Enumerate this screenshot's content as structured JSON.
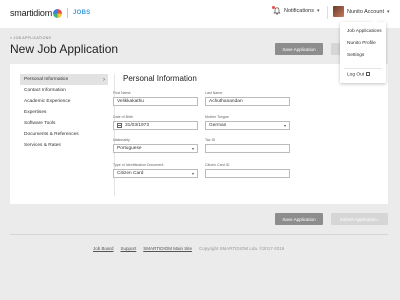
{
  "brand": {
    "name": "smartidiom",
    "product": "JOBS",
    "colors": {
      "accent": "#3a9de0",
      "red": "#e94b4b",
      "yellow": "#f3c13a",
      "green": "#3bb37a",
      "blue": "#3a7ee0"
    }
  },
  "header": {
    "notifications_label": "Notifications",
    "account_name": "Nunito Account",
    "menu": {
      "items": [
        "Job Applications",
        "Nunito Profile",
        "Settings"
      ],
      "logout_label": "Log Out"
    }
  },
  "breadcrumb": "« JOB APPLICATIONS",
  "page_title": "New Job Application",
  "actions": {
    "save_label": "Save Application",
    "submit_label": "Submit Application ›"
  },
  "sidebar": {
    "items": [
      {
        "label": "Personal Information",
        "active": true
      },
      {
        "label": "Contact Information"
      },
      {
        "label": "Academic Experience"
      },
      {
        "label": "Expertises"
      },
      {
        "label": "Software Tools"
      },
      {
        "label": "Documents & References"
      },
      {
        "label": "Services & Rates"
      }
    ]
  },
  "form": {
    "section_title": "Personal Information",
    "first_name": {
      "label": "First Name",
      "value": "Velikkakathu"
    },
    "last_name": {
      "label": "Last Name",
      "value": "Achuthanandan"
    },
    "dob": {
      "label": "Date of Birth",
      "value": "31/03/1973"
    },
    "mother_tongue": {
      "label": "Mother Tongue",
      "value": "German"
    },
    "nationality": {
      "label": "Nationality",
      "value": "Portuguese"
    },
    "tax_id": {
      "label": "Tax ID",
      "value": ""
    },
    "id_doc_type": {
      "label": "Type of Identification Document",
      "value": "Citizen Card"
    },
    "citizen_card_id": {
      "label": "Citizen Card ID",
      "value": ""
    }
  },
  "footer": {
    "links": [
      "Job Board",
      "Support",
      "SMARTIDIOM Main Site"
    ],
    "copyright": "Copyright SMARTIDIOM Lda. ©2017-2019"
  }
}
